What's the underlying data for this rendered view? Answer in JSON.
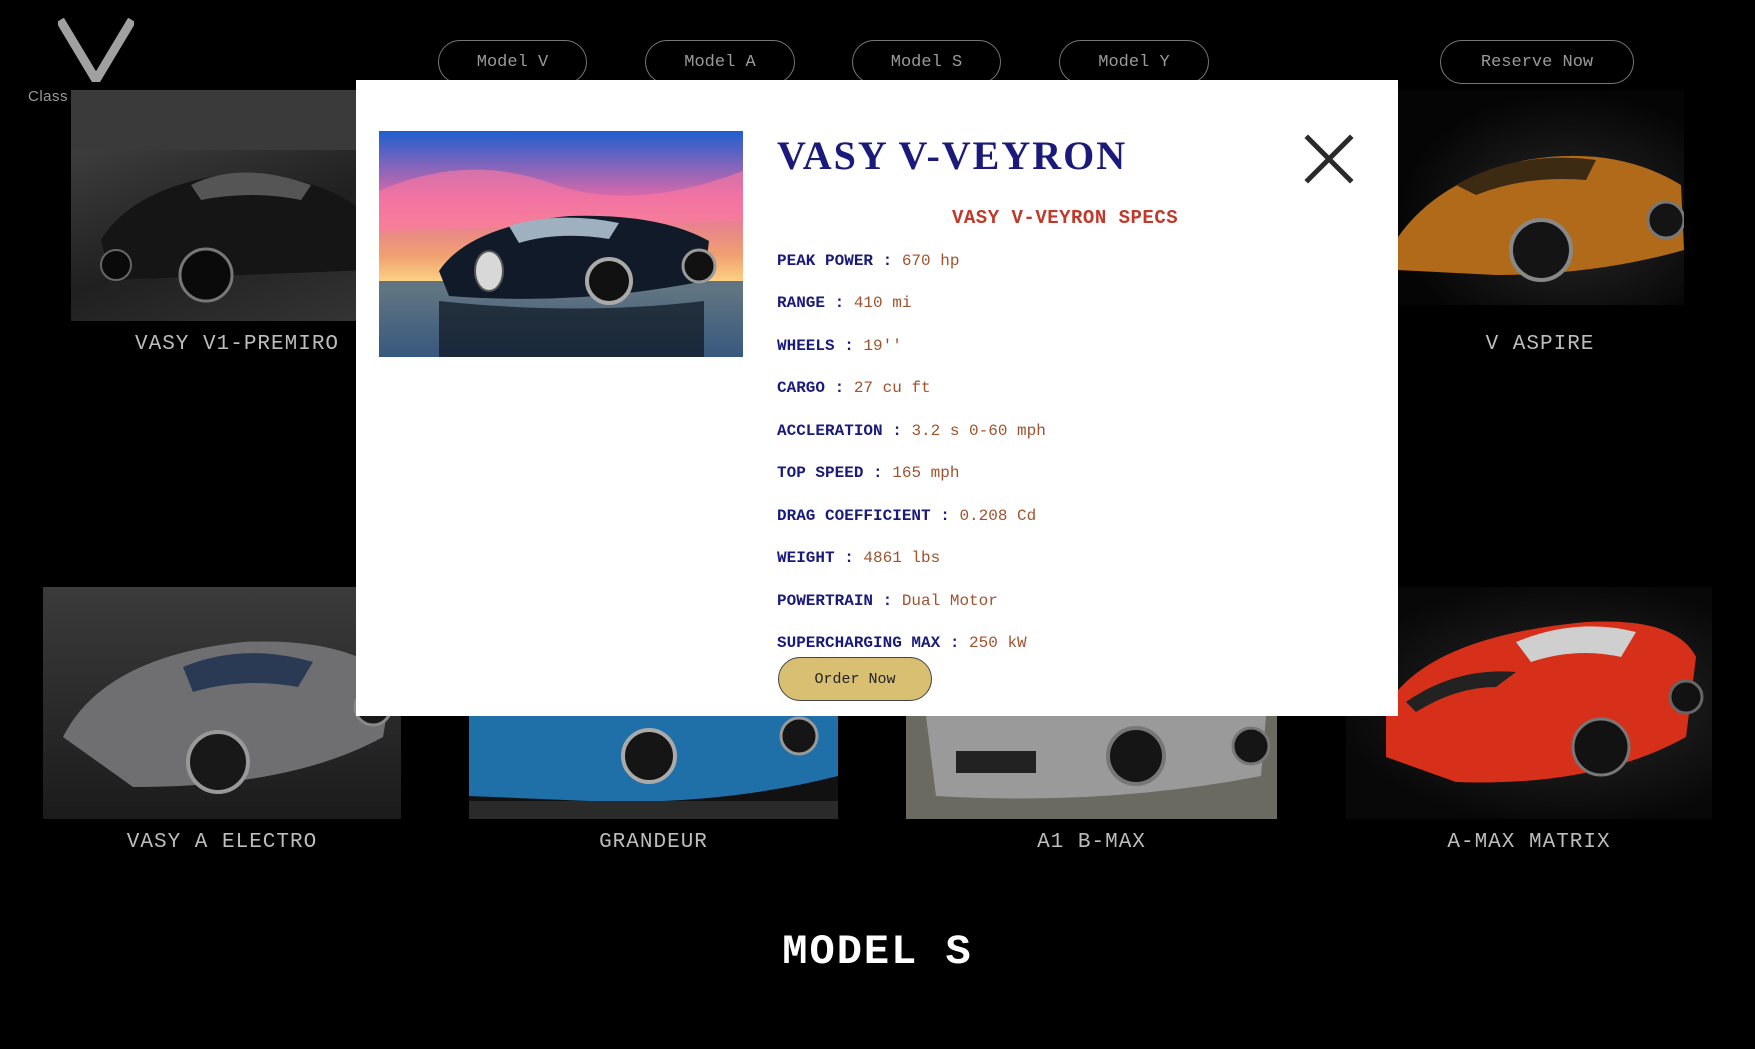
{
  "brand": {
    "tagline": "Class redefined."
  },
  "nav": [
    {
      "label": "Model V"
    },
    {
      "label": "Model A"
    },
    {
      "label": "Model S"
    },
    {
      "label": "Model Y"
    }
  ],
  "reserve_label": "Reserve Now",
  "cards": [
    {
      "title": "VASY V1-PREMIRO"
    },
    {
      "title": "V ASPIRE"
    },
    {
      "title": "VASY A ELECTRO"
    },
    {
      "title": "GRANDEUR"
    },
    {
      "title": "A1 B-MAX"
    },
    {
      "title": "A-MAX MATRIX"
    }
  ],
  "section_title": "MODEL S",
  "modal": {
    "title": "VASY V-VEYRON",
    "specs_heading": "VASY V-VEYRON SPECS",
    "specs": [
      {
        "label": "PEAK POWER",
        "value": "670 hp"
      },
      {
        "label": "RANGE",
        "value": "410 mi"
      },
      {
        "label": "WHEELS",
        "value": "19''"
      },
      {
        "label": "CARGO",
        "value": "27 cu ft"
      },
      {
        "label": "ACCLERATION",
        "value": "3.2 s 0-60 mph"
      },
      {
        "label": "TOP SPEED",
        "value": "165 mph"
      },
      {
        "label": "DRAG COEFFICIENT",
        "value": "0.208 Cd"
      },
      {
        "label": "WEIGHT",
        "value": "4861 lbs"
      },
      {
        "label": "POWERTRAIN",
        "value": "Dual Motor"
      },
      {
        "label": "SUPERCHARGING MAX",
        "value": "250 kW"
      }
    ],
    "order_label": "Order Now"
  },
  "colors": {
    "background": "#000000",
    "modal_title": "#1a1a7a",
    "spec_heading": "#c0392b",
    "spec_value": "#a0522d",
    "order_button": "#d9bf72"
  }
}
